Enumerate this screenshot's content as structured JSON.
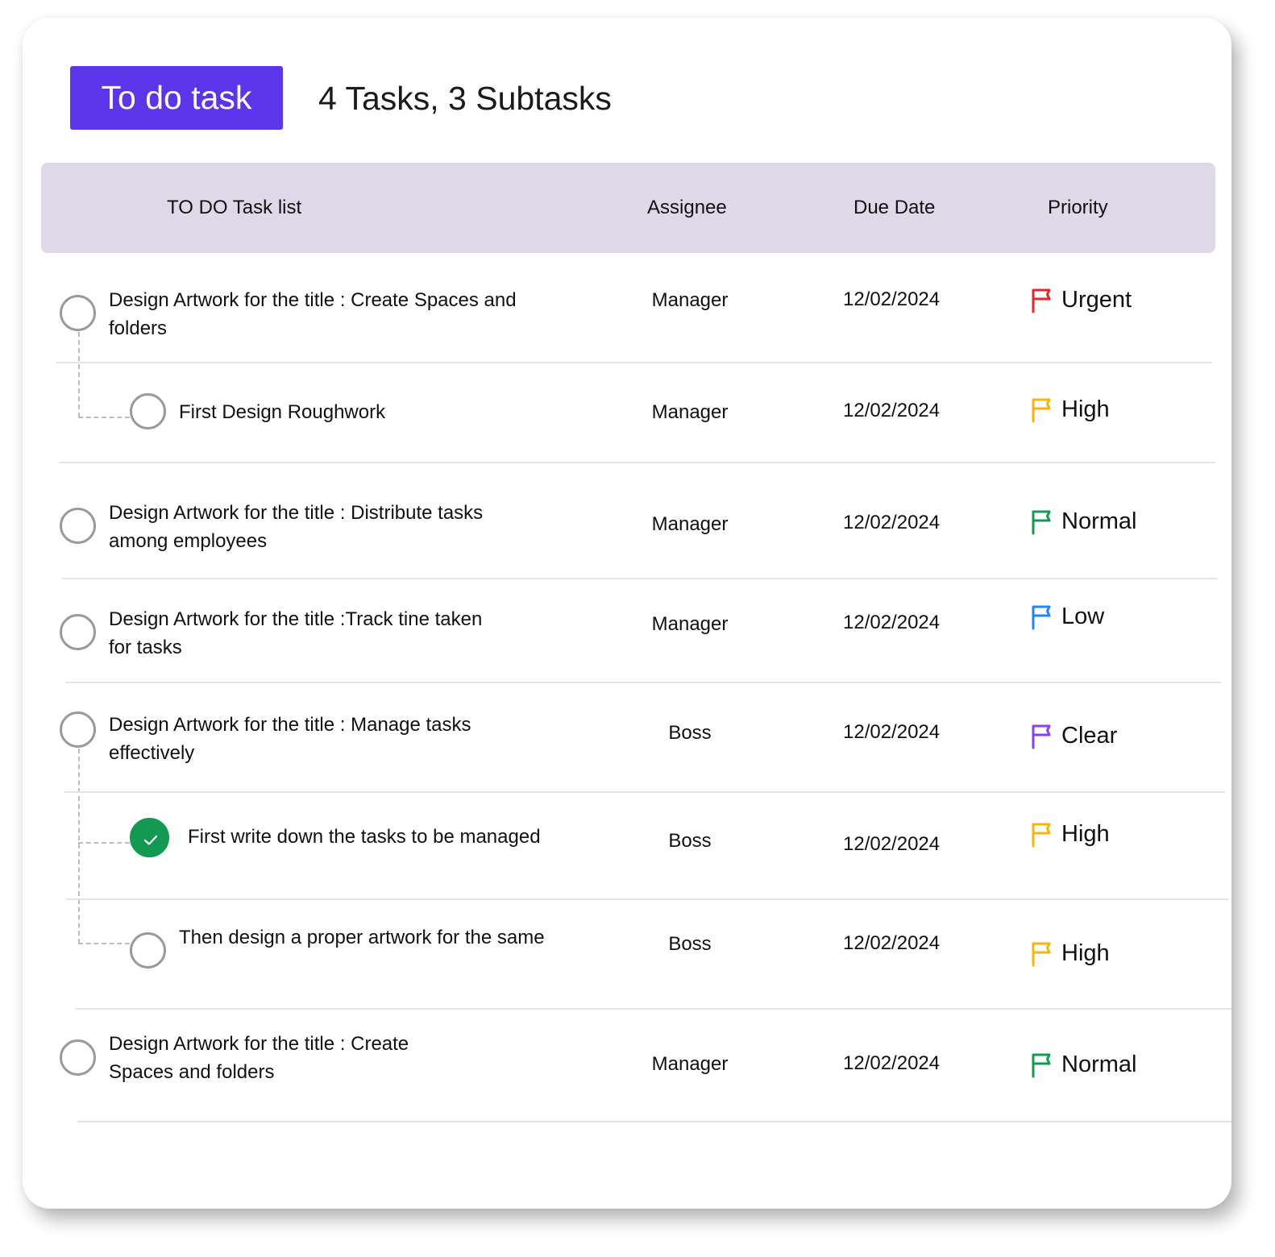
{
  "header": {
    "button_label": "To do task",
    "summary": "4 Tasks, 3 Subtasks"
  },
  "table": {
    "columns": {
      "task": "TO DO Task list",
      "assignee": "Assignee",
      "due_date": "Due Date",
      "priority": "Priority"
    },
    "rows": [
      {
        "type": "task",
        "completed": false,
        "text": "Design Artwork for the title : Create Spaces and folders",
        "assignee": "Manager",
        "due_date": "12/02/2024",
        "priority": "Urgent",
        "priority_color": "#e5262b"
      },
      {
        "type": "subtask",
        "completed": false,
        "text": "First Design Roughwork",
        "assignee": "Manager",
        "due_date": "12/02/2024",
        "priority": "High",
        "priority_color": "#fbb40c"
      },
      {
        "type": "task",
        "completed": false,
        "text": "Design Artwork for the title : Distribute tasks among employees",
        "assignee": "Manager",
        "due_date": "12/02/2024",
        "priority": "Normal",
        "priority_color": "#139a52"
      },
      {
        "type": "task",
        "completed": false,
        "text": "Design Artwork for the title :Track tine taken for tasks",
        "assignee": "Manager",
        "due_date": "12/02/2024",
        "priority": "Low",
        "priority_color": "#1e86ff"
      },
      {
        "type": "task",
        "completed": false,
        "text": "Design Artwork for the title : Manage tasks effectively",
        "assignee": "Boss",
        "due_date": "12/02/2024",
        "priority": "Clear",
        "priority_color": "#8a3ff3"
      },
      {
        "type": "subtask",
        "completed": true,
        "text": "First write down the tasks to be managed",
        "assignee": "Boss",
        "due_date": "12/02/2024",
        "priority": "High",
        "priority_color": "#fbb40c"
      },
      {
        "type": "subtask",
        "completed": false,
        "text": "Then design a proper artwork for the same",
        "assignee": "Boss",
        "due_date": "12/02/2024",
        "priority": "High",
        "priority_color": "#fbb40c"
      },
      {
        "type": "task",
        "completed": false,
        "text": "Design Artwork for the title : Create Spaces and folders",
        "assignee": "Manager",
        "due_date": "12/02/2024",
        "priority": "Normal",
        "priority_color": "#139a52"
      }
    ]
  },
  "colors": {
    "accent": "#5b35ea",
    "header_bg": "#dfd8e8",
    "complete_green": "#139a52"
  },
  "icons": {
    "checkbox": "circle-checkbox-icon",
    "checked": "check-icon",
    "priority": "flag-icon"
  }
}
